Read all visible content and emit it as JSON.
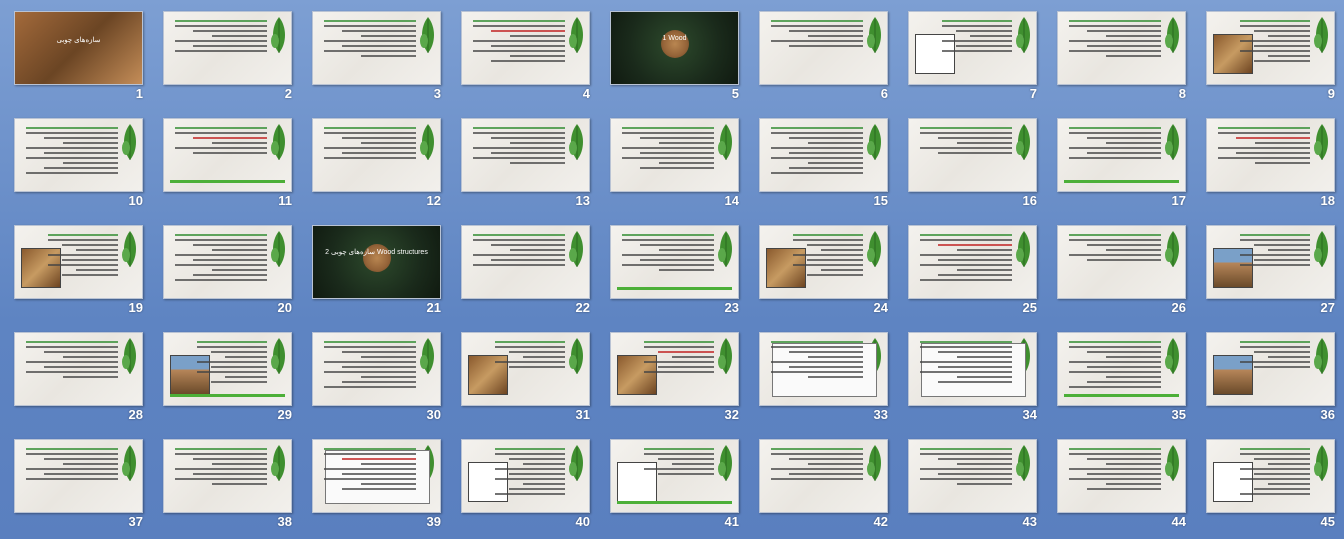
{
  "slides": [
    {
      "number": "1",
      "kind": "photo",
      "title": "سازه‌های چوبی"
    },
    {
      "number": "2",
      "kind": "text"
    },
    {
      "number": "3",
      "kind": "text"
    },
    {
      "number": "4",
      "kind": "text"
    },
    {
      "number": "5",
      "kind": "dark",
      "title": "1 Wood"
    },
    {
      "number": "6",
      "kind": "text"
    },
    {
      "number": "7",
      "kind": "pic",
      "pic": "sketch"
    },
    {
      "number": "8",
      "kind": "text"
    },
    {
      "number": "9",
      "kind": "pic",
      "pic": "wood"
    },
    {
      "number": "10",
      "kind": "text"
    },
    {
      "number": "11",
      "kind": "text"
    },
    {
      "number": "12",
      "kind": "text"
    },
    {
      "number": "13",
      "kind": "text"
    },
    {
      "number": "14",
      "kind": "text"
    },
    {
      "number": "15",
      "kind": "text"
    },
    {
      "number": "16",
      "kind": "text"
    },
    {
      "number": "17",
      "kind": "text"
    },
    {
      "number": "18",
      "kind": "text"
    },
    {
      "number": "19",
      "kind": "pic",
      "pic": "wood"
    },
    {
      "number": "20",
      "kind": "text"
    },
    {
      "number": "21",
      "kind": "dark",
      "title": "2 سازه‌های چوبی Wood structures"
    },
    {
      "number": "22",
      "kind": "text"
    },
    {
      "number": "23",
      "kind": "text"
    },
    {
      "number": "24",
      "kind": "pic",
      "pic": "wood"
    },
    {
      "number": "25",
      "kind": "text"
    },
    {
      "number": "26",
      "kind": "text"
    },
    {
      "number": "27",
      "kind": "pic",
      "pic": "house"
    },
    {
      "number": "28",
      "kind": "text"
    },
    {
      "number": "29",
      "kind": "pic",
      "pic": "house"
    },
    {
      "number": "30",
      "kind": "text"
    },
    {
      "number": "31",
      "kind": "pic",
      "pic": "wood"
    },
    {
      "number": "32",
      "kind": "pic",
      "pic": "wood"
    },
    {
      "number": "33",
      "kind": "frame"
    },
    {
      "number": "34",
      "kind": "frame"
    },
    {
      "number": "35",
      "kind": "text"
    },
    {
      "number": "36",
      "kind": "pic",
      "pic": "house"
    },
    {
      "number": "37",
      "kind": "text"
    },
    {
      "number": "38",
      "kind": "text"
    },
    {
      "number": "39",
      "kind": "frame"
    },
    {
      "number": "40",
      "kind": "pic",
      "pic": "sketch"
    },
    {
      "number": "41",
      "kind": "pic",
      "pic": "sketch"
    },
    {
      "number": "42",
      "kind": "text"
    },
    {
      "number": "43",
      "kind": "text"
    },
    {
      "number": "44",
      "kind": "text"
    },
    {
      "number": "45",
      "kind": "pic",
      "pic": "sketch"
    }
  ],
  "colors": {
    "background": "#6b8fca",
    "number": "#ffffff",
    "leaf": "#3f8f2f"
  }
}
